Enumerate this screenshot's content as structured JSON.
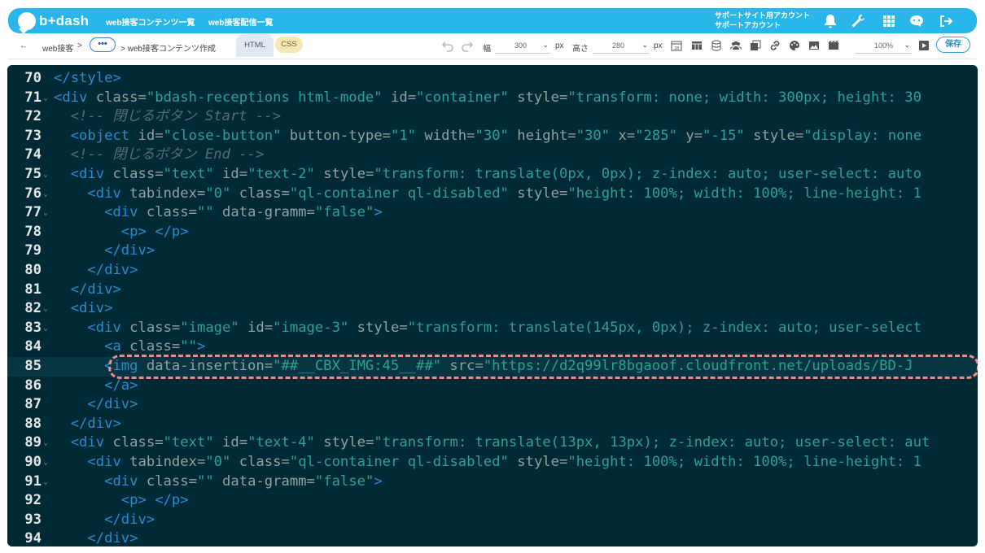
{
  "header": {
    "logo_text": "b+dash",
    "nav": [
      "web接客コンテンツ一覧",
      "web接客配信一覧"
    ],
    "account_line1": "サポートサイト用アカウント",
    "account_line2": "サポートアカウント",
    "icons": [
      "bell-icon",
      "wrench-icon",
      "grid-icon",
      "chat-bot-icon",
      "logout-icon"
    ]
  },
  "toolbar": {
    "back_symbol": "←",
    "crumb_root": "web接客",
    "crumb_sep": ">",
    "crumb_more": "•••",
    "crumb_current": "> web接客コンテンツ作成",
    "tab_html": "HTML",
    "tab_css": "CSS",
    "width_label": "幅",
    "width_value": "300",
    "height_label": "高さ",
    "height_value": "280",
    "unit": "px",
    "zoom_value": "100%",
    "save_label": "保存"
  },
  "editor": {
    "lines": [
      {
        "n": "70",
        "text": "</style>"
      },
      {
        "n": "71",
        "text": "<div class=\"bdash-receptions html-mode\" id=\"container\" style=\"transform: none; width: 300px; height: 30"
      },
      {
        "n": "72",
        "text": "  <!-- 閉じるボタン Start -->"
      },
      {
        "n": "73",
        "text": "  <object id=\"close-button\" button-type=\"1\" width=\"30\" height=\"30\" x=\"285\" y=\"-15\" style=\"display: none"
      },
      {
        "n": "74",
        "text": "  <!-- 閉じるボタン End -->"
      },
      {
        "n": "75",
        "text": "  <div class=\"text\" id=\"text-2\" style=\"transform: translate(0px, 0px); z-index: auto; user-select: auto"
      },
      {
        "n": "76",
        "text": "    <div tabindex=\"0\" class=\"ql-container ql-disabled\" style=\"height: 100%; width: 100%; line-height: 1"
      },
      {
        "n": "77",
        "text": "      <div class=\"\" data-gramm=\"false\">"
      },
      {
        "n": "78",
        "text": "        <p> </p>"
      },
      {
        "n": "79",
        "text": "      </div>"
      },
      {
        "n": "80",
        "text": "    </div>"
      },
      {
        "n": "81",
        "text": "  </div>"
      },
      {
        "n": "82",
        "text": "  <div>"
      },
      {
        "n": "83",
        "text": "    <div class=\"image\" id=\"image-3\" style=\"transform: translate(145px, 0px); z-index: auto; user-select"
      },
      {
        "n": "84",
        "text": "      <a class=\"\">"
      },
      {
        "n": "85",
        "text": "      <img data-insertion=\"##__CBX_IMG:45__##\" src=\"https://d2q99lr8bgaoof.cloudfront.net/uploads/BD-J"
      },
      {
        "n": "86",
        "text": "      </a>"
      },
      {
        "n": "87",
        "text": "    </div>"
      },
      {
        "n": "88",
        "text": "  </div>"
      },
      {
        "n": "89",
        "text": "  <div class=\"text\" id=\"text-4\" style=\"transform: translate(13px, 13px); z-index: auto; user-select: aut"
      },
      {
        "n": "90",
        "text": "    <div tabindex=\"0\" class=\"ql-container ql-disabled\" style=\"height: 100%; width: 100%; line-height: 1"
      },
      {
        "n": "91",
        "text": "      <div class=\"\" data-gramm=\"false\">"
      },
      {
        "n": "92",
        "text": "        <p> </p>"
      },
      {
        "n": "93",
        "text": "      </div>"
      },
      {
        "n": "94",
        "text": "    </div>"
      }
    ],
    "active_line": "85",
    "highlighted_line": "85",
    "highlight_color": "#f08a8a",
    "background_color": "#002b36"
  }
}
